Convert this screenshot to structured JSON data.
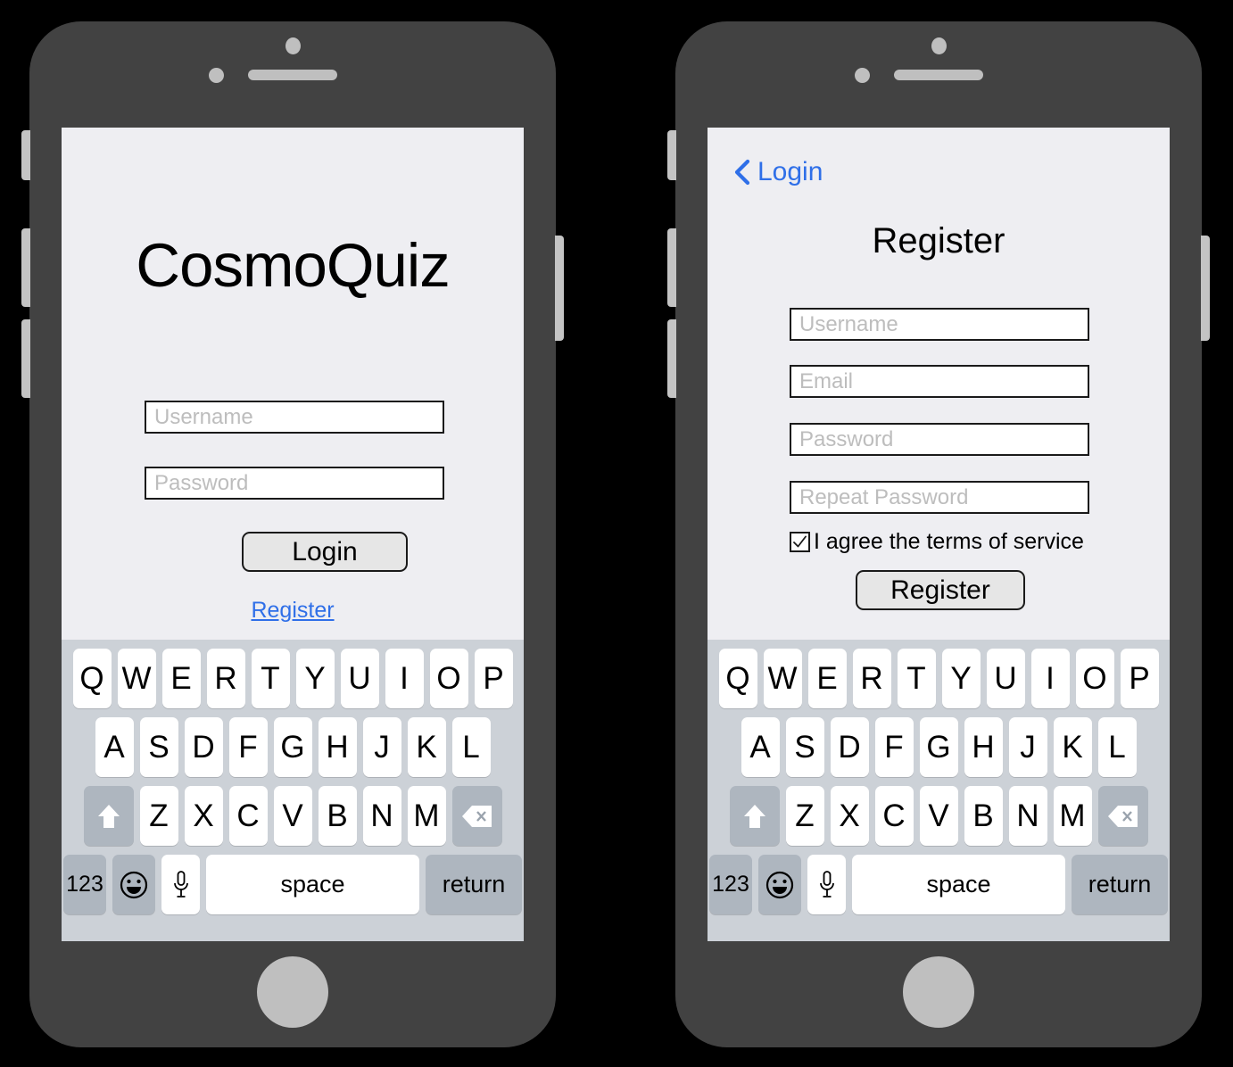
{
  "colors": {
    "chassis": "#424242",
    "screen_bg": "#eeeef2",
    "keyboard_bg": "#ccd1d7",
    "key_white": "#ffffff",
    "key_gray": "#aeb6bf",
    "accent_blue": "#2f6fe8",
    "placeholder": "#bdbdbd",
    "button_fill": "#e6e6e6",
    "hardware_gray": "#bfbfbf"
  },
  "login_screen": {
    "app_title": "CosmoQuiz",
    "username_placeholder": "Username",
    "password_placeholder": "Password",
    "login_button": "Login",
    "register_link": "Register"
  },
  "register_screen": {
    "back_label": "Login",
    "back_icon": "chevron-left-icon",
    "title": "Register",
    "username_placeholder": "Username",
    "email_placeholder": "Email",
    "password_placeholder": "Password",
    "repeat_password_placeholder": "Repeat Password",
    "terms_label": "I agree the terms of service",
    "terms_checked": true,
    "register_button": "Register"
  },
  "keyboard": {
    "row1": [
      "Q",
      "W",
      "E",
      "R",
      "T",
      "Y",
      "U",
      "I",
      "O",
      "P"
    ],
    "row2": [
      "A",
      "S",
      "D",
      "F",
      "G",
      "H",
      "J",
      "K",
      "L"
    ],
    "row3_letters": [
      "Z",
      "X",
      "C",
      "V",
      "B",
      "N",
      "M"
    ],
    "shift_icon": "shift-arrow-icon",
    "backspace_icon": "backspace-icon",
    "numeric_key": "123",
    "emoji_icon": "emoji-smiley-icon",
    "mic_icon": "microphone-icon",
    "space_key": "space",
    "return_key": "return"
  },
  "hardware": {
    "camera": "front-camera",
    "sensor": "proximity-sensor",
    "speaker": "earpiece-speaker",
    "home": "home-button",
    "mute_switch": "mute-switch",
    "volume_up": "volume-up-button",
    "volume_down": "volume-down-button",
    "power": "power-button"
  }
}
